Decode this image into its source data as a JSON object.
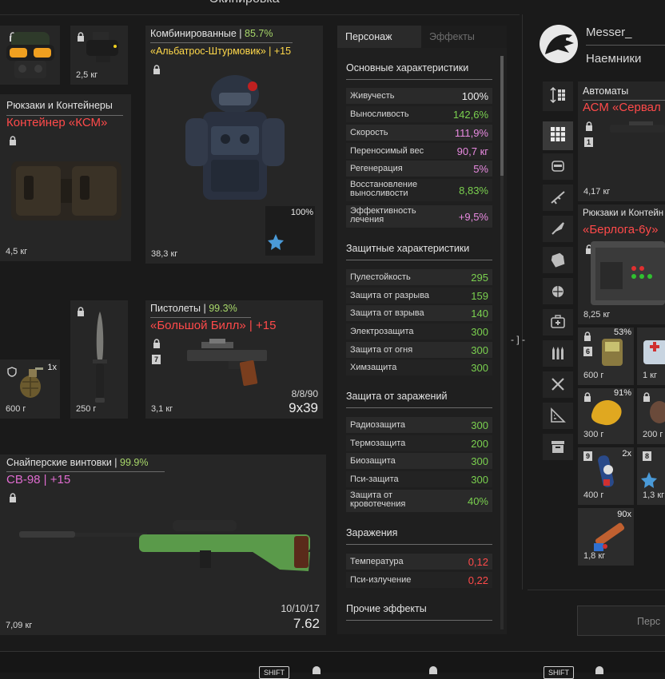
{
  "window_title": "Экипировка",
  "left": {
    "helmet_slot": {},
    "nv_slot": {
      "weight": "2,5 кг"
    },
    "backpack": {
      "category": "Рюкзаки и Контейнеры",
      "name": "Контейнер «КСМ»",
      "weight": "4,5 кг"
    },
    "armor": {
      "category": "Комбинированные",
      "durability": "85.7%",
      "name": "«Альбатрос-Штурмовик» | +15",
      "weight": "38,3 кг",
      "mod_percent": "100%"
    },
    "grenade": {
      "count": "1x",
      "weight": "600 г"
    },
    "knife": {
      "weight": "250 г"
    },
    "pistol": {
      "category": "Пистолеты",
      "durability": "99.3%",
      "name": "«Большой Билл» | +15",
      "weight": "3,1 кг",
      "badge": "7",
      "ammo": "8/8/90",
      "caliber": "9x39"
    },
    "sniper": {
      "category": "Снайперские винтовки",
      "durability": "99.9%",
      "name": "СВ-98 | +15",
      "weight": "7,09 кг",
      "ammo": "10/10/17",
      "caliber": "7.62"
    }
  },
  "stats": {
    "tabs": [
      {
        "label": "Персонаж",
        "active": true
      },
      {
        "label": "Эффекты",
        "active": false
      }
    ],
    "sections": [
      {
        "title": "Основные характеристики",
        "rows": [
          {
            "label": "Живучесть",
            "value": "100%",
            "color": "#ececec"
          },
          {
            "label": "Выносливость",
            "value": "142,6%",
            "color": "#7ad04f"
          },
          {
            "label": "Скорость",
            "value": "111,9%",
            "color": "#e88ae0"
          },
          {
            "label": "Переносимый вес",
            "value": "90,7 кг",
            "color": "#e88ae0"
          },
          {
            "label": "Регенерация",
            "value": "5%",
            "color": "#e88ae0"
          },
          {
            "label": "Восстановление выносливости",
            "value": "8,83%",
            "color": "#7ad04f"
          },
          {
            "label": "Эффективность лечения",
            "value": "+9,5%",
            "color": "#e88ae0"
          }
        ]
      },
      {
        "title": "Защитные характеристики",
        "rows": [
          {
            "label": "Пулестойкость",
            "value": "295",
            "color": "#7ad04f"
          },
          {
            "label": "Защита от разрыва",
            "value": "159",
            "color": "#7ad04f"
          },
          {
            "label": "Защита от взрыва",
            "value": "140",
            "color": "#7ad04f"
          },
          {
            "label": "Электрозащита",
            "value": "300",
            "color": "#7ad04f"
          },
          {
            "label": "Защита от огня",
            "value": "300",
            "color": "#7ad04f"
          },
          {
            "label": "Химзащита",
            "value": "300",
            "color": "#7ad04f"
          }
        ]
      },
      {
        "title": "Защита от заражений",
        "rows": [
          {
            "label": "Радиозащита",
            "value": "300",
            "color": "#7ad04f"
          },
          {
            "label": "Термозащита",
            "value": "200",
            "color": "#7ad04f"
          },
          {
            "label": "Биозащита",
            "value": "300",
            "color": "#7ad04f"
          },
          {
            "label": "Пси-защита",
            "value": "300",
            "color": "#7ad04f"
          },
          {
            "label": "Защита от кровотечения",
            "value": "40%",
            "color": "#7ad04f"
          }
        ]
      },
      {
        "title": "Заражения",
        "rows": [
          {
            "label": "Температура",
            "value": "0,12",
            "color": "#ff4a4a"
          },
          {
            "label": "Пси-излучение",
            "value": "0,22",
            "color": "#ff4a4a"
          }
        ]
      },
      {
        "title": "Прочие эффекты",
        "rows": []
      }
    ]
  },
  "right": {
    "username": "Messer_",
    "faction": "Наемники",
    "side_icons": [
      "sort-icon",
      "grid-icon",
      "helmet-icon",
      "rifle-icon",
      "knife-icon",
      "armor-icon",
      "grenade-icon",
      "medkit-icon",
      "ammo-icon",
      "tools-icon",
      "ruler-icon",
      "crate-icon"
    ],
    "automat": {
      "category": "Автоматы",
      "name": "АСМ «Сервал",
      "badge": "1",
      "weight": "4,17 кг"
    },
    "backpack2": {
      "category": "Рюкзаки и Контейн",
      "name": "«Берлога-6у»",
      "weight": "8,25 кг"
    },
    "items": [
      {
        "badge": "6",
        "corner": "53%",
        "weight": "600 г"
      },
      {
        "badge": "",
        "corner": "",
        "weight": "1 кг"
      },
      {
        "badge": "",
        "corner": "91%",
        "weight": "300 г"
      },
      {
        "badge": "",
        "corner": "",
        "weight": "200 г"
      },
      {
        "badge": "9",
        "corner": "2x",
        "weight": "400 г"
      },
      {
        "badge": "8",
        "corner": "",
        "weight": "1,3 кг"
      },
      {
        "badge": "",
        "corner": "90x",
        "weight": "1,8 кг"
      }
    ],
    "bottom_button": "Перс"
  },
  "bottom_bar": {
    "keys": [
      "SHIFT",
      "SHIFT"
    ]
  }
}
